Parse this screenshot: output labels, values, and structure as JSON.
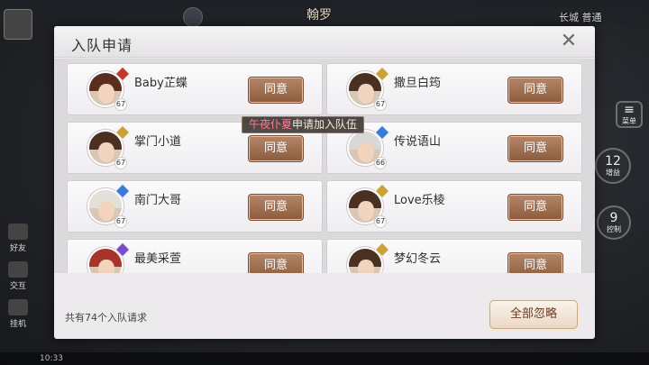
{
  "dialog": {
    "title": "入队申请",
    "close_icon": "close-icon",
    "request_count_text": "共有74个入队请求",
    "ignore_all_label": "全部忽略"
  },
  "toast": {
    "player_name": "午夜仆夏",
    "message": "申请加入队伍",
    "highlight_color": "#ff7a96"
  },
  "agree_label": "同意",
  "requests": [
    {
      "name": "Baby芷蝶",
      "level": "67",
      "class_color": "#c0392b",
      "hair_color": "#5a2e1e"
    },
    {
      "name": "撒旦白筠",
      "level": "67",
      "class_color": "#c9a23a",
      "hair_color": "#4a3020"
    },
    {
      "name": "掌门小道",
      "level": "67",
      "class_color": "#c9a23a",
      "hair_color": "#4a3020"
    },
    {
      "name": "传说语山",
      "level": "66",
      "class_color": "#3a7bd5",
      "hair_color": "#d8d8d8"
    },
    {
      "name": "南门大哥",
      "level": "67",
      "class_color": "#3a7bd5",
      "hair_color": "#e3e0da"
    },
    {
      "name": "Love乐棱",
      "level": "67",
      "class_color": "#c9a23a",
      "hair_color": "#4a3020"
    },
    {
      "name": "最美采萱",
      "level": "",
      "class_color": "#7c4cc4",
      "hair_color": "#a8332b"
    },
    {
      "name": "梦幻冬云",
      "level": "",
      "class_color": "#c9a23a",
      "hair_color": "#4a3020"
    }
  ],
  "hud": {
    "location_text": "长城 普通",
    "banner_text": "翰罗",
    "menu_label": "菜单",
    "btn_12_value": "12",
    "btn_12_label": "增益",
    "btn_9_value": "9",
    "btn_9_label": "控制",
    "friend_label": "好友",
    "trade_label": "交互",
    "hang_label": "挂机",
    "time_text": "10:33"
  }
}
